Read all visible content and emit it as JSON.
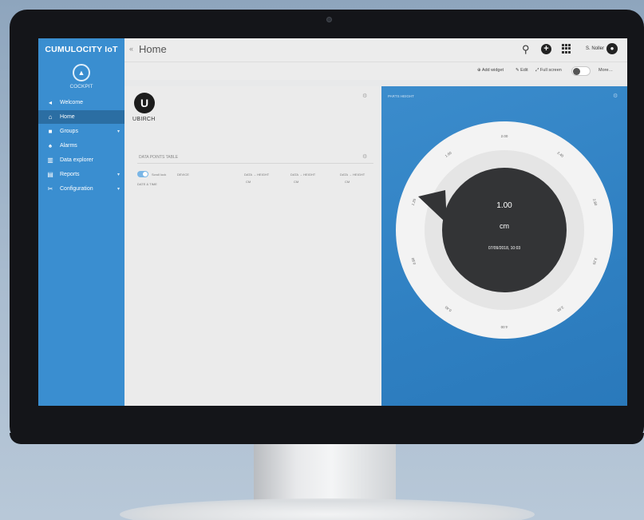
{
  "sidebar": {
    "brand": "CUMULOCITY IoT",
    "app_label": "COCKPIT",
    "items": [
      {
        "label": "Welcome",
        "icon": "megaphone-icon"
      },
      {
        "label": "Home",
        "icon": "home-icon"
      },
      {
        "label": "Groups",
        "icon": "folder-icon"
      },
      {
        "label": "Alarms",
        "icon": "bell-icon"
      },
      {
        "label": "Data explorer",
        "icon": "chart-icon"
      },
      {
        "label": "Reports",
        "icon": "report-icon"
      },
      {
        "label": "Configuration",
        "icon": "tools-icon"
      }
    ]
  },
  "header": {
    "title": "Home",
    "user": "S. Noller"
  },
  "actions": {
    "add_widget": "⊕ Add widget",
    "edit": "✎ Edit",
    "full_screen": "⤢ Full screen",
    "more": "More…"
  },
  "widgets": {
    "logo_text": "UBIRCH",
    "data_points": {
      "title": "DATA POINTS TABLE",
      "scroll_lock": "Scroll lock",
      "device_col": "DEVICE",
      "date_col": "DATE & TIME",
      "value_cols": [
        {
          "header": "DATA → HEIGHT",
          "unit": "CM"
        },
        {
          "header": "DATA → HEIGHT",
          "unit": "CM"
        },
        {
          "header": "DATA → HEIGHT",
          "unit": "CM"
        }
      ]
    },
    "gauge": {
      "title": "PARTS HEIGHT",
      "value": "1.00",
      "unit": "cm",
      "timestamp": "07/09/2018, 10:03",
      "tick_labels": [
        "2.00",
        "2.40",
        "2.80",
        "3.20",
        "3.60",
        "4.00",
        "0.40",
        "0.80",
        "1.20",
        "1.60"
      ]
    }
  }
}
